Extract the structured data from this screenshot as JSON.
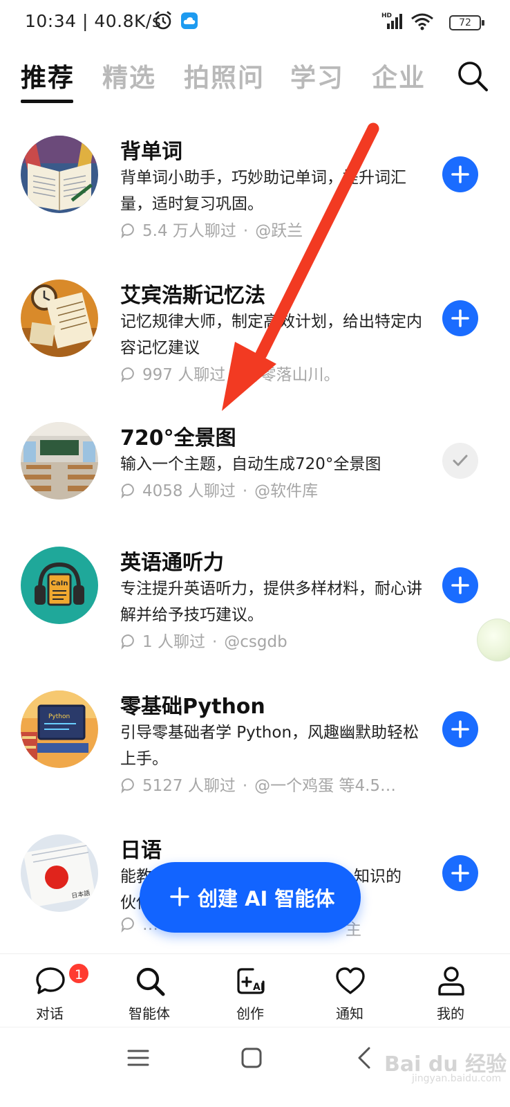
{
  "status_bar": {
    "time_speed": "10:34 | 40.8K/s",
    "battery": "72",
    "icons": [
      "alarm-icon",
      "cloud-app-icon",
      "hd-signal-icon",
      "wifi-icon",
      "battery-icon"
    ]
  },
  "tabs": [
    {
      "label": "推荐",
      "active": true
    },
    {
      "label": "精选",
      "active": false
    },
    {
      "label": "拍照问",
      "active": false
    },
    {
      "label": "学习",
      "active": false
    },
    {
      "label": "企业",
      "active": false
    }
  ],
  "list": [
    {
      "title": "背单词",
      "desc": "背单词小助手，巧妙助记单词，提升词汇量，适时复习巩固。",
      "count": "5.4 万人聊过",
      "author": "@跃兰",
      "added": false
    },
    {
      "title": "艾宾浩斯记忆法",
      "desc": "记忆规律大师，制定高效计划，给出特定内容记忆建议",
      "count": "997 人聊过",
      "author": "@零落山川。",
      "added": false
    },
    {
      "title": "720°全景图",
      "desc": "输入一个主题，自动生成720°全景图",
      "count": "4058 人聊过",
      "author": "@软件库",
      "added": true
    },
    {
      "title": "英语通听力",
      "desc": "专注提升英语听力，提供多样材料，耐心讲解并给予技巧建议。",
      "count": "1 人聊过",
      "author": "@csgdb",
      "added": false
    },
    {
      "title": "零基础Python",
      "desc": "引导零基础者学 Python，风趣幽默助轻松上手。",
      "count": "5127 人聊过",
      "author": "@一个鸡蛋 等4.5…",
      "added": false
    },
    {
      "title": "日语",
      "desc": "能教",
      "desc_tail": "知识的",
      "desc_line2": "伙伴",
      "count": "14",
      "author": "主",
      "added": false
    }
  ],
  "meta_separator": "·",
  "create_button": {
    "label": "创建 AI 智能体"
  },
  "bottom_nav": [
    {
      "label": "对话",
      "icon": "chat-bubble-icon",
      "badge": "1"
    },
    {
      "label": "智能体",
      "icon": "search-icon"
    },
    {
      "label": "创作",
      "icon": "create-ai-icon",
      "icon_text": "AI"
    },
    {
      "label": "通知",
      "icon": "heart-icon"
    },
    {
      "label": "我的",
      "icon": "person-icon"
    }
  ],
  "watermark": {
    "text": "Bai du 经验",
    "sub": "jingyan.baidu.com"
  },
  "colors": {
    "accent": "#1a6cff",
    "tab_inactive": "#b9b9b9",
    "meta_gray": "#a6a6a6",
    "annotation_arrow": "#f23a22",
    "badge_red": "#ff3b30"
  }
}
